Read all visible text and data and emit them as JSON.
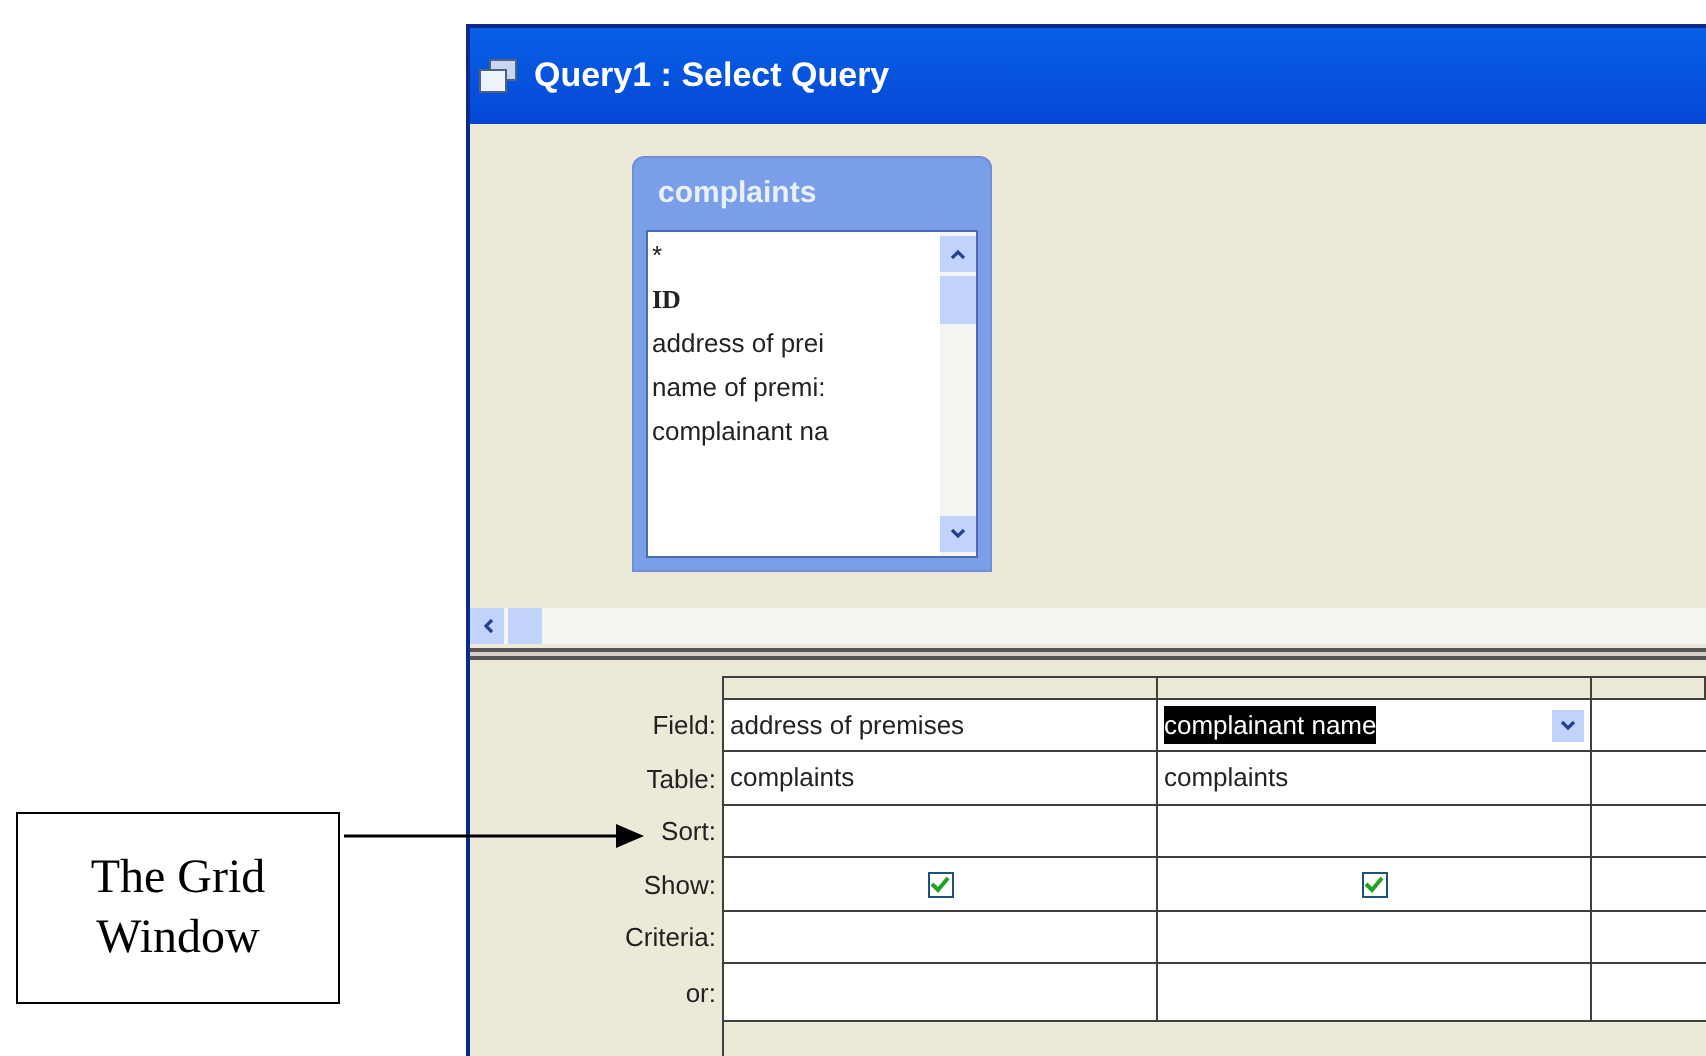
{
  "window": {
    "title": "Query1 : Select Query"
  },
  "table_box": {
    "title": "complaints",
    "fields": [
      {
        "text": "*",
        "bold": false
      },
      {
        "text": "ID",
        "bold": true
      },
      {
        "text": "address of prei",
        "bold": false
      },
      {
        "text": "name of premi:",
        "bold": false
      },
      {
        "text": "complainant na",
        "bold": false
      }
    ]
  },
  "grid": {
    "row_labels": [
      "Field:",
      "Table:",
      "Sort:",
      "Show:",
      "Criteria:",
      "or:"
    ],
    "columns": [
      {
        "field": "address of premises",
        "table": "complaints",
        "show": true,
        "selected": false
      },
      {
        "field": "complainant name",
        "table": "complaints",
        "show": true,
        "selected": true
      }
    ]
  },
  "annotation": {
    "text": "The Grid Window"
  }
}
